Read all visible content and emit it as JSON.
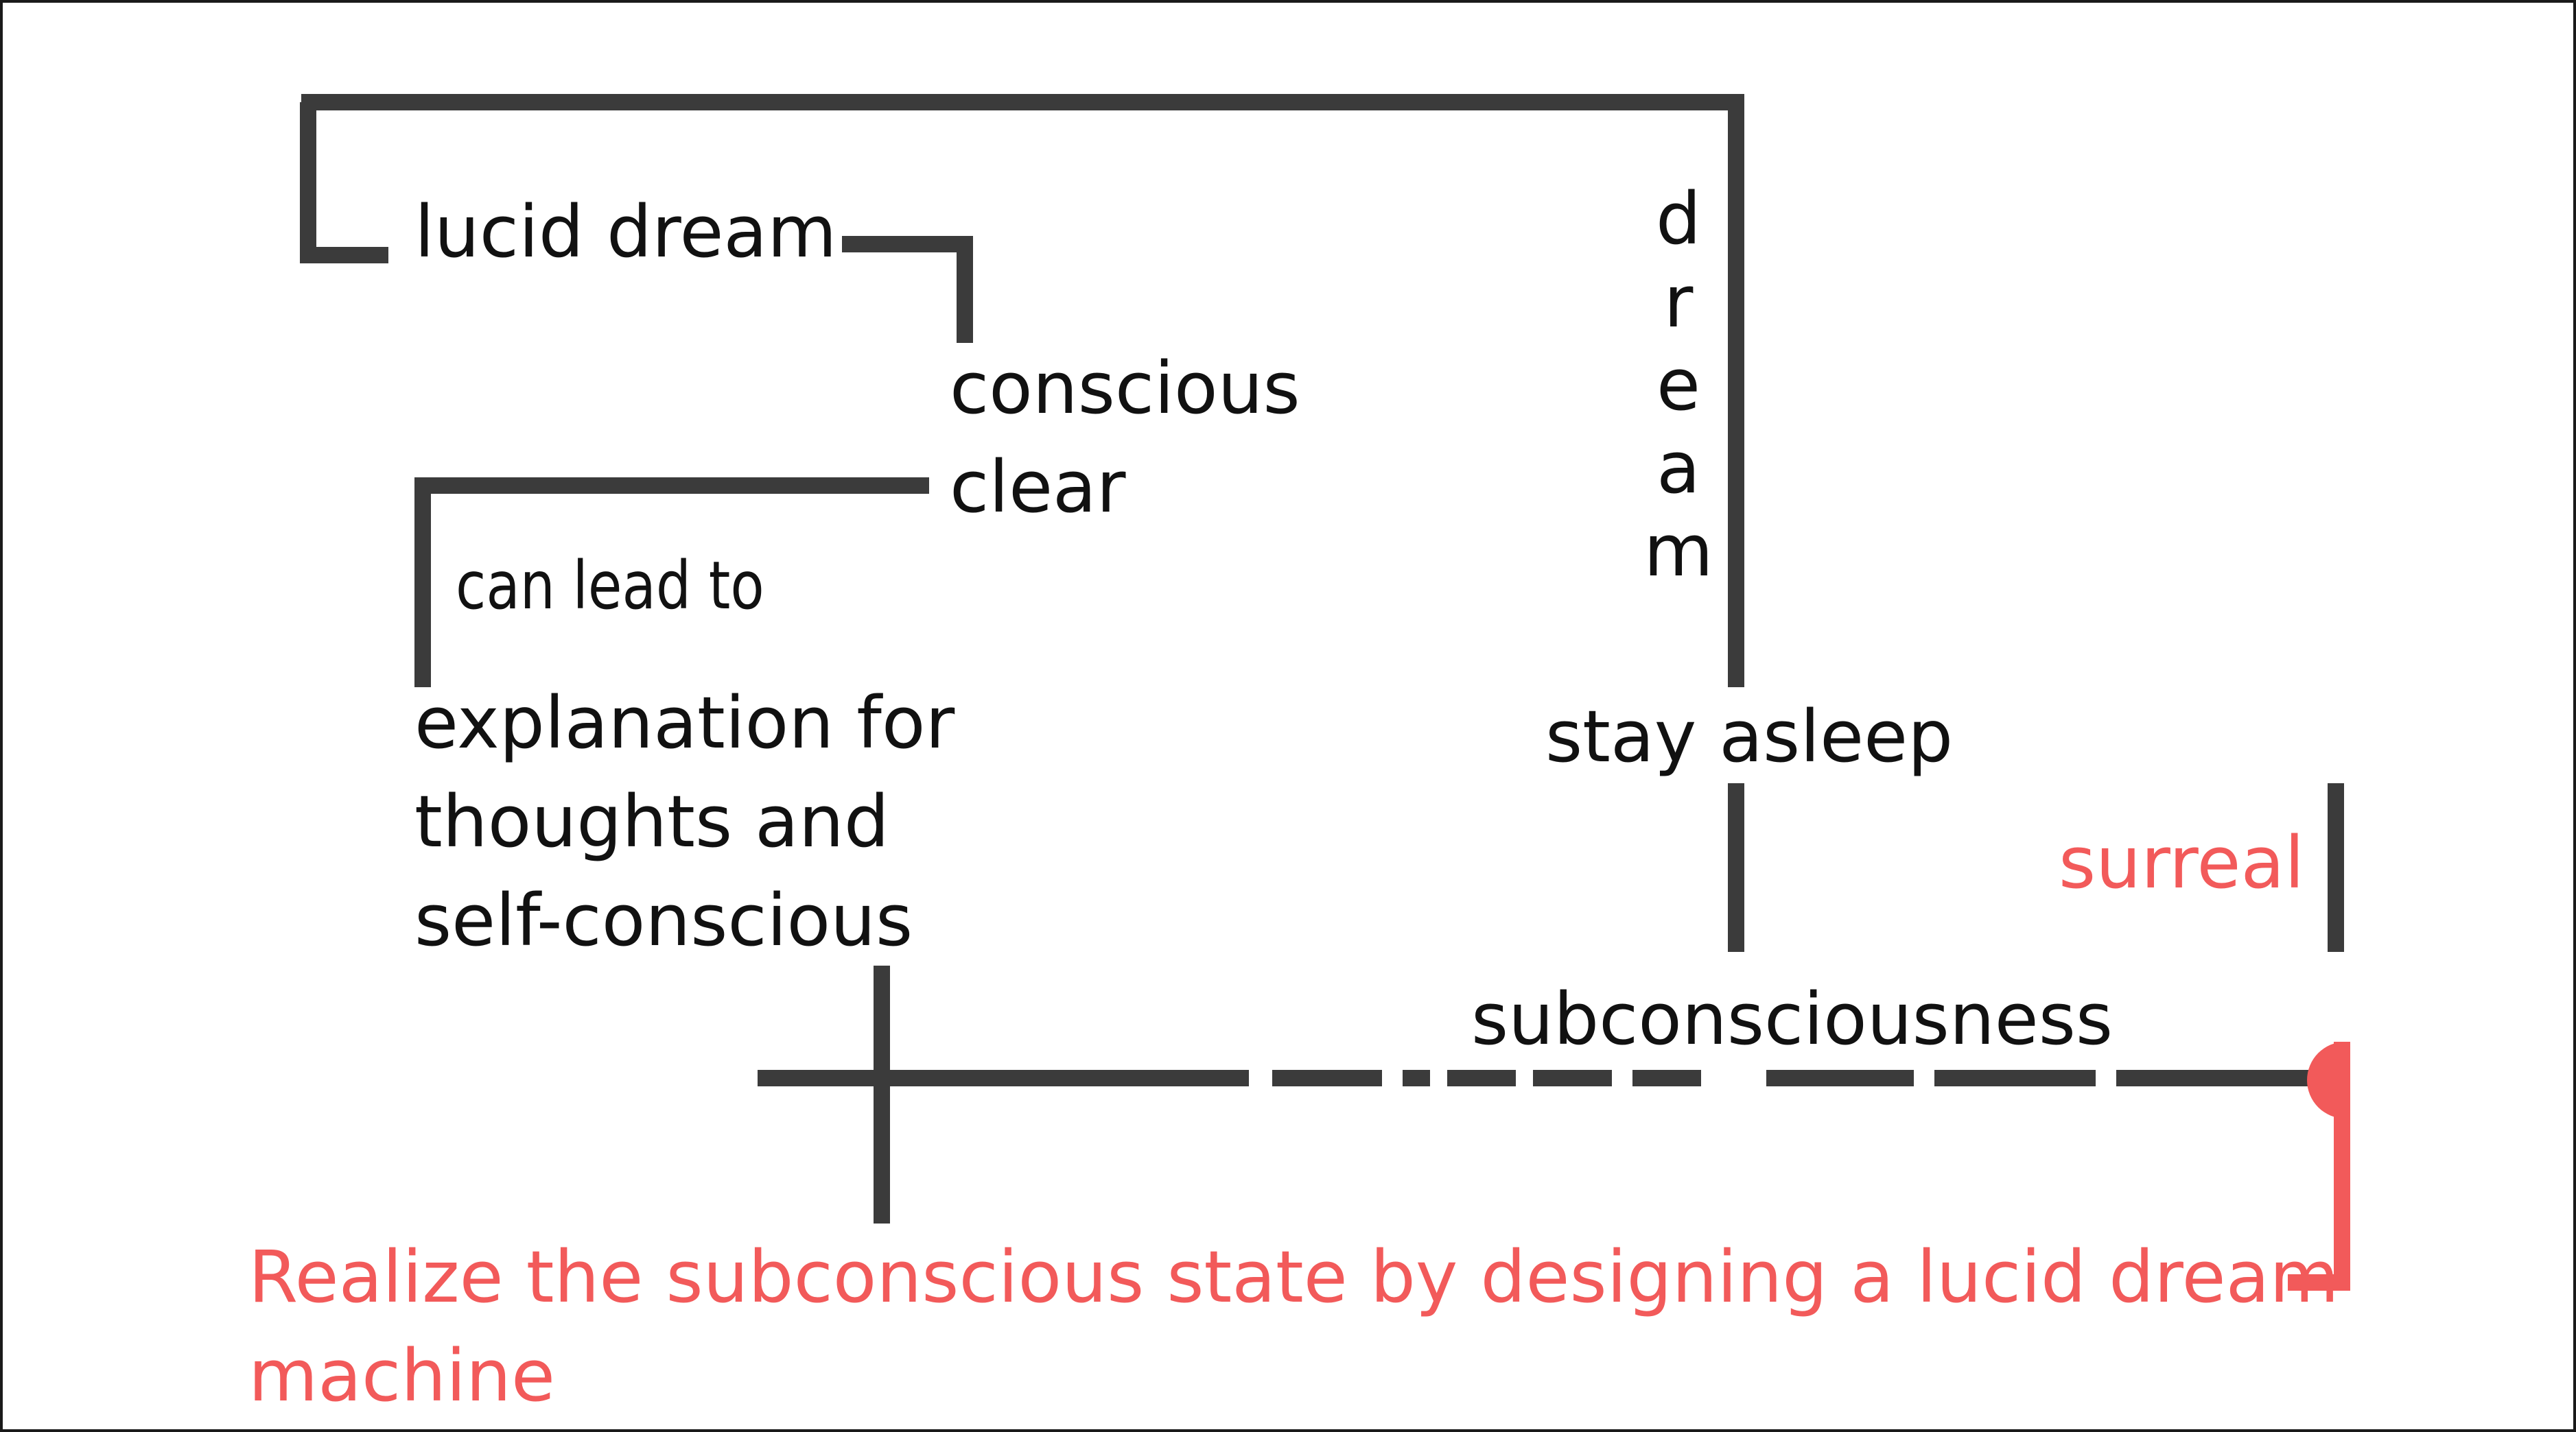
{
  "diagram": {
    "colors": {
      "ink": "#111111",
      "connector": "#3b3b3b",
      "accent": "#f25a5a",
      "background": "#ffffff"
    },
    "labels": {
      "lucid_dream": "lucid dream",
      "conscious": "conscious",
      "clear": "clear",
      "can_lead_to": "can lead to",
      "explanation_lines": [
        "explanation for",
        "thoughts and",
        "self-conscious"
      ],
      "dream_letters": [
        "d",
        "r",
        "e",
        "a",
        "m"
      ],
      "stay_asleep": "stay asleep",
      "surreal": "surreal",
      "subconsciousness": "subconsciousness",
      "realize_lines": [
        "Realize the subconscious state by designing a lucid dream",
        "machine"
      ]
    }
  }
}
